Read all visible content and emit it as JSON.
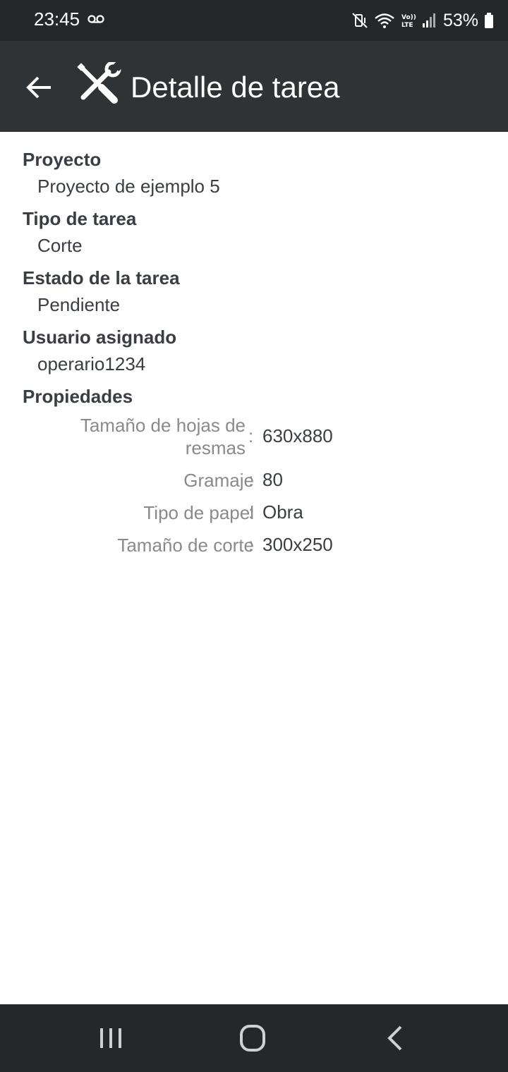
{
  "status_bar": {
    "time": "23:45",
    "battery": "53%",
    "icons": [
      "voicemail-icon",
      "vibrate-mute-icon",
      "wifi-icon",
      "volte-icon",
      "signal-icon",
      "battery-icon"
    ]
  },
  "app_bar": {
    "title": "Detalle de tarea",
    "icons": [
      "back-arrow-icon",
      "tools-icon"
    ]
  },
  "task": {
    "project_label": "Proyecto",
    "project_value": "Proyecto de ejemplo 5",
    "type_label": "Tipo de tarea",
    "type_value": "Corte",
    "state_label": "Estado de la tarea",
    "state_value": "Pendiente",
    "user_label": "Usuario asignado",
    "user_value": "operario1234",
    "properties_label": "Propiedades",
    "properties": [
      {
        "key_line1": "Tamaño de hojas de",
        "key_line2": "resmas",
        "value": "630x880"
      },
      {
        "key": "Gramaje",
        "value": "80"
      },
      {
        "key": "Tipo de papel",
        "value": "Obra"
      },
      {
        "key": "Tamaño de corte",
        "value": "300x250"
      }
    ],
    "separator": ":"
  },
  "nav_bar": {
    "icons": [
      "recent-apps-icon",
      "home-icon",
      "back-icon"
    ]
  },
  "colors": {
    "status_bar_bg": "#25282b",
    "app_bar_bg": "#303336",
    "label_text": "#3a3d44",
    "property_key_text": "#8a8a8a"
  }
}
